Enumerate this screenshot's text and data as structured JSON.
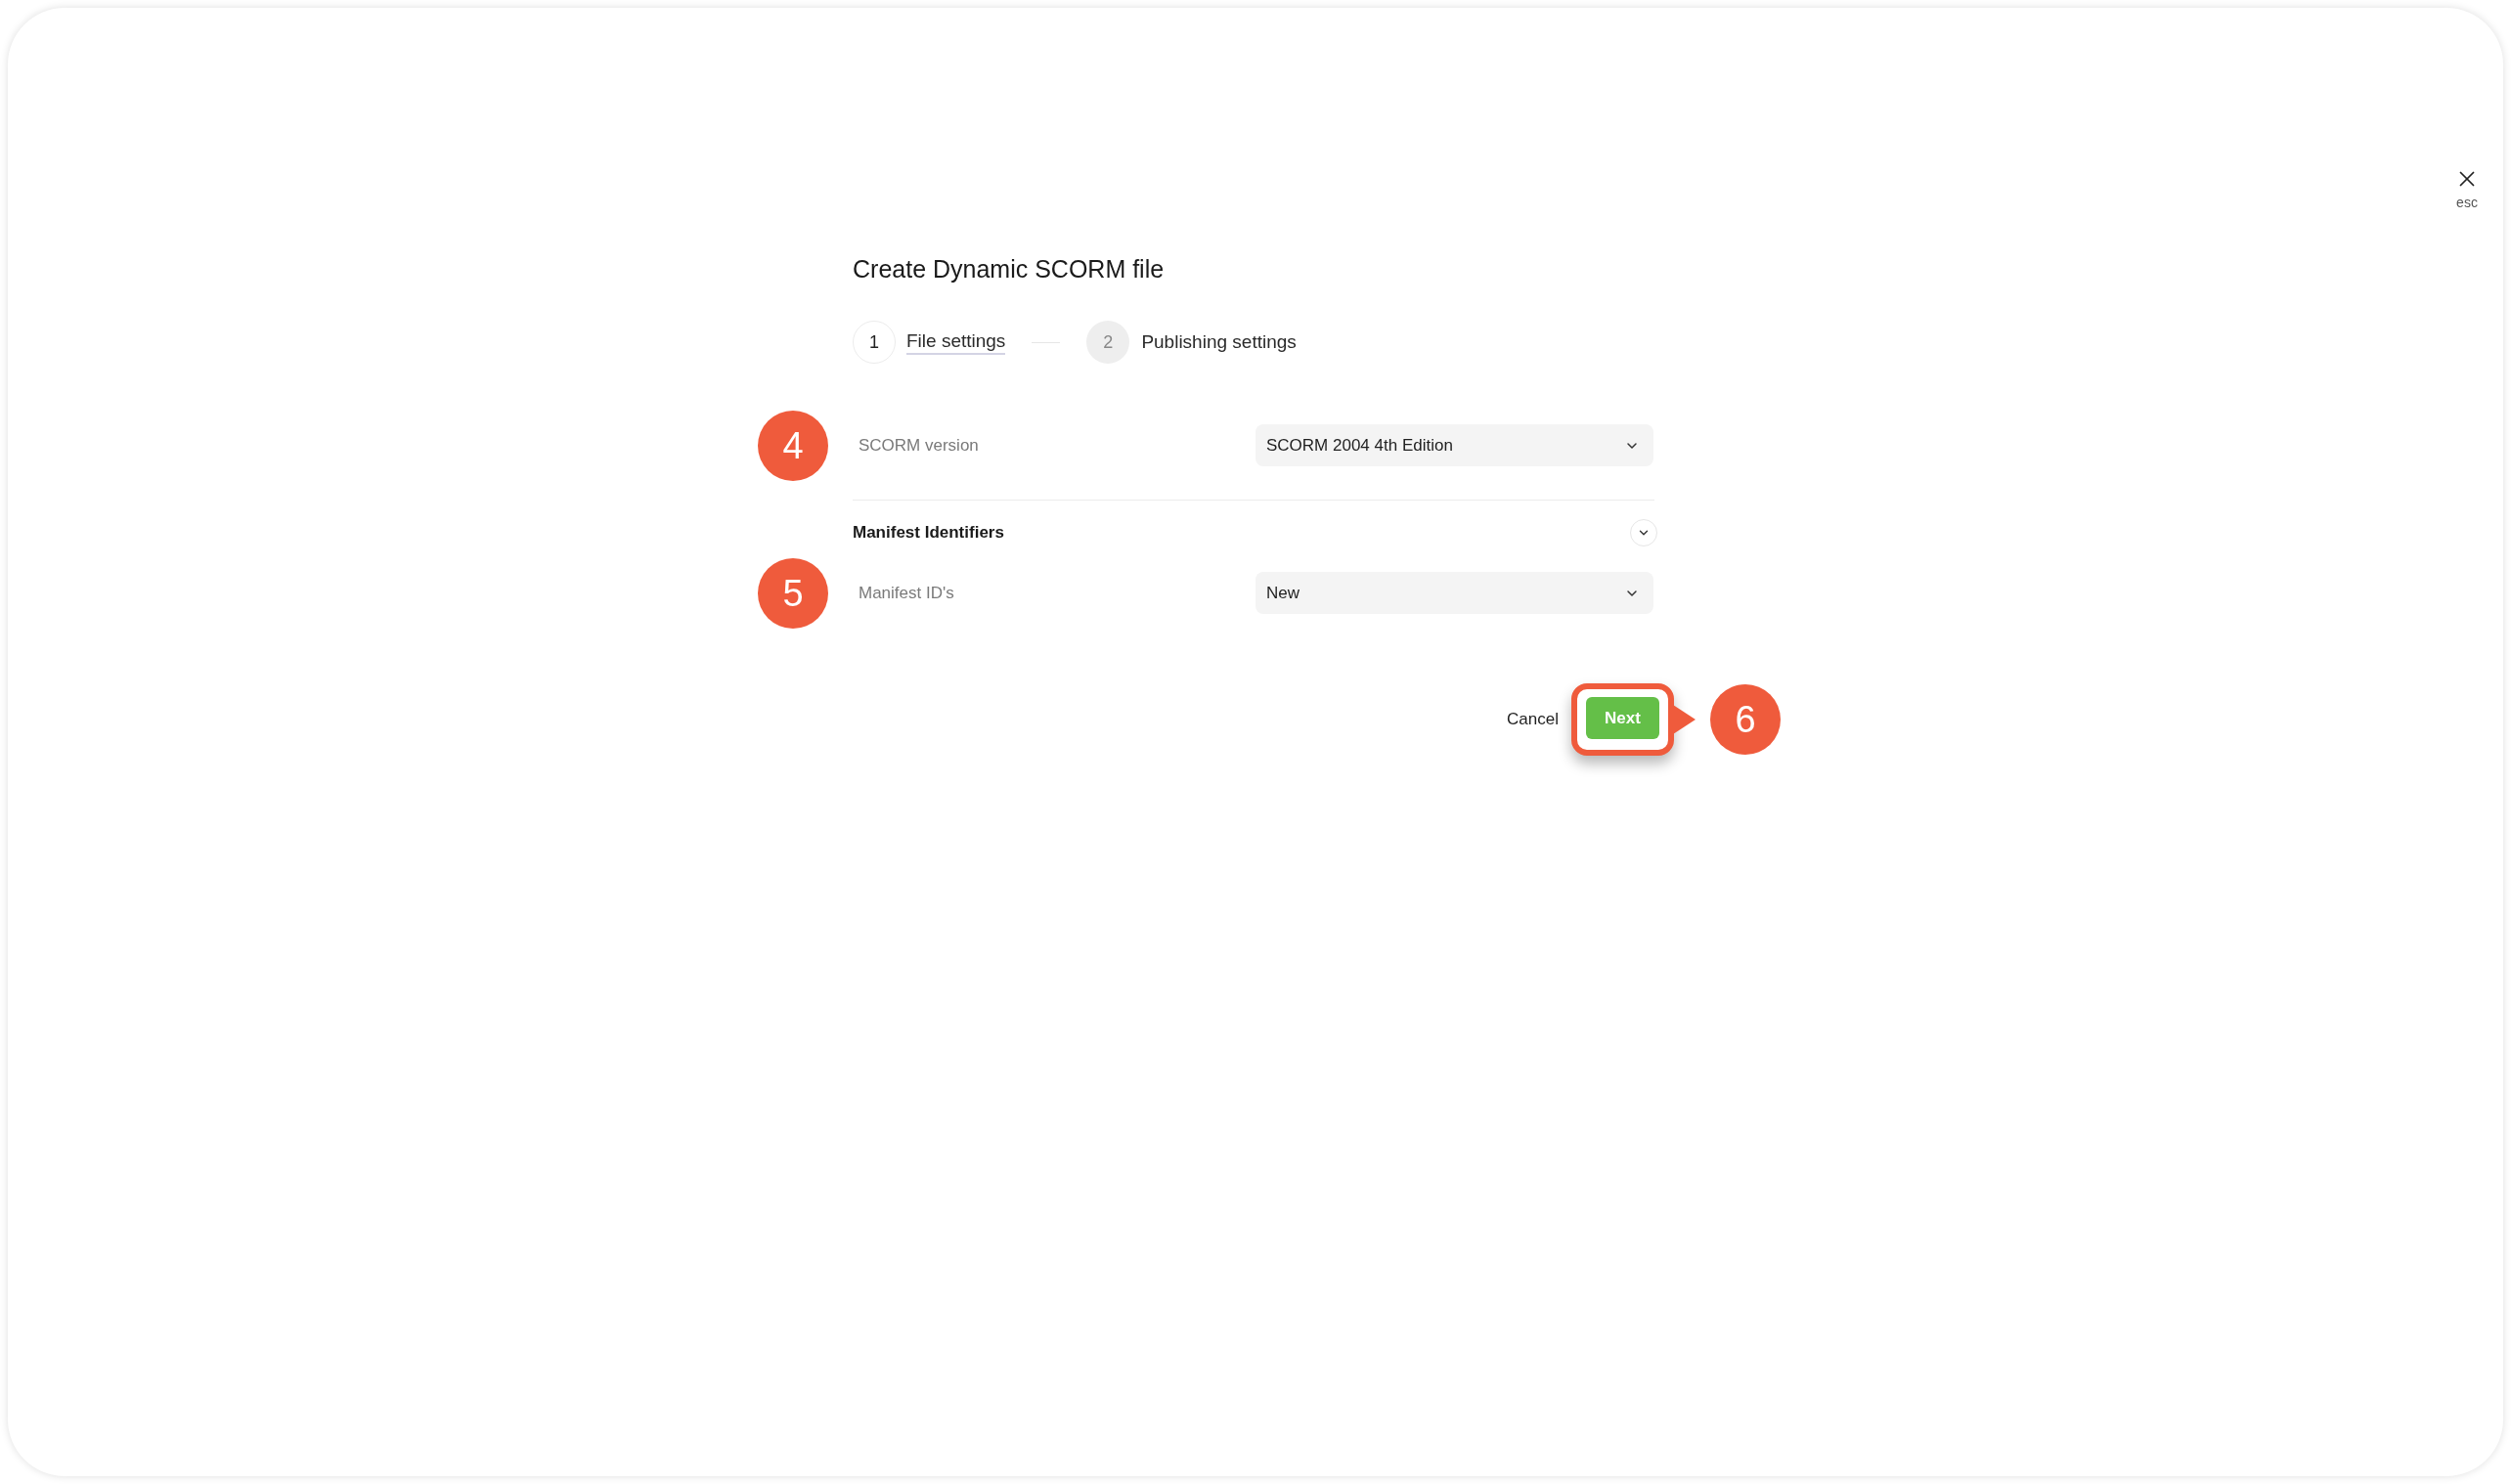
{
  "close": {
    "hint": "esc"
  },
  "dialog": {
    "title": "Create Dynamic SCORM file",
    "steps": [
      {
        "number": "1",
        "label": "File settings",
        "selected": true
      },
      {
        "number": "2",
        "label": "Publishing settings",
        "selected": false
      }
    ],
    "rows": [
      {
        "marker": "4",
        "label": "SCORM version",
        "value": "SCORM 2004 4th Edition"
      }
    ],
    "section": {
      "title": "Manifest Identifiers",
      "expanded": true,
      "rows": [
        {
          "marker": "5",
          "label": "Manifest ID's",
          "value": "New"
        }
      ]
    },
    "buttons": [
      {
        "kind": "text",
        "label": "Cancel"
      },
      {
        "kind": "primary",
        "label": "Next",
        "callout": "6"
      }
    ]
  }
}
